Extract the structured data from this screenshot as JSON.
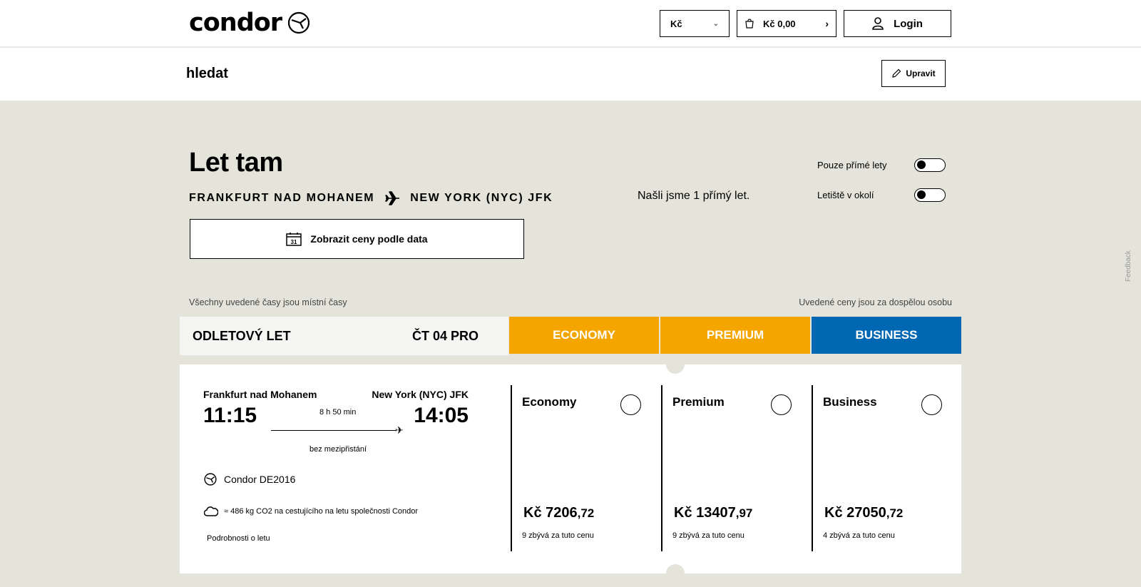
{
  "header": {
    "logo_text": "condor",
    "currency": "Kč",
    "cart_label": "Kč 0,00",
    "login_label": "Login"
  },
  "subheader": {
    "title": "hledat",
    "edit_label": "Upravit"
  },
  "hero": {
    "title": "Let tam",
    "origin": "FRANKFURT NAD MOHANEM",
    "destination": "NEW YORK (NYC) JFK",
    "found_text": "Našli jsme 1 přímý let.",
    "toggle_direct": "Pouze přímé lety",
    "toggle_nearby": "Letiště v okolí",
    "date_button": "Zobrazit ceny podle data",
    "calendar_day": "31"
  },
  "notes": {
    "local_times": "Všechny uvedené časy jsou místní časy",
    "price_per_adult": "Uvedené ceny jsou za dospělou osobu"
  },
  "table": {
    "flight_header": "ODLETOVÝ LET",
    "date_header": "ČT 04 PRO",
    "cabins": [
      "ECONOMY",
      "PREMIUM",
      "BUSINESS"
    ],
    "cabin_colors": {
      "economy": "#f5a500",
      "premium": "#f5a500",
      "business": "#0067b3"
    }
  },
  "flight": {
    "from_city": "Frankfurt nad Mohanem",
    "to_city": "New York (NYC) JFK",
    "departure": "11:15",
    "arrival": "14:05",
    "duration": "8 h 50 min",
    "stops": "bez mezipřistání",
    "carrier": "Condor DE2016",
    "co2": "≈ 486 kg CO2 na cestujícího na letu společnosti Condor",
    "details_link": "Podrobnosti o letu"
  },
  "fares": [
    {
      "name": "Economy",
      "price_main": "Kč 7206",
      "price_dec": ",72",
      "remaining": "9 zbývá za tuto cenu"
    },
    {
      "name": "Premium",
      "price_main": "Kč 13407",
      "price_dec": ",97",
      "remaining": "9 zbývá za tuto cenu"
    },
    {
      "name": "Business",
      "price_main": "Kč 27050",
      "price_dec": ",72",
      "remaining": "4 zbývá za tuto cenu"
    }
  ],
  "feedback_label": "Feedback"
}
